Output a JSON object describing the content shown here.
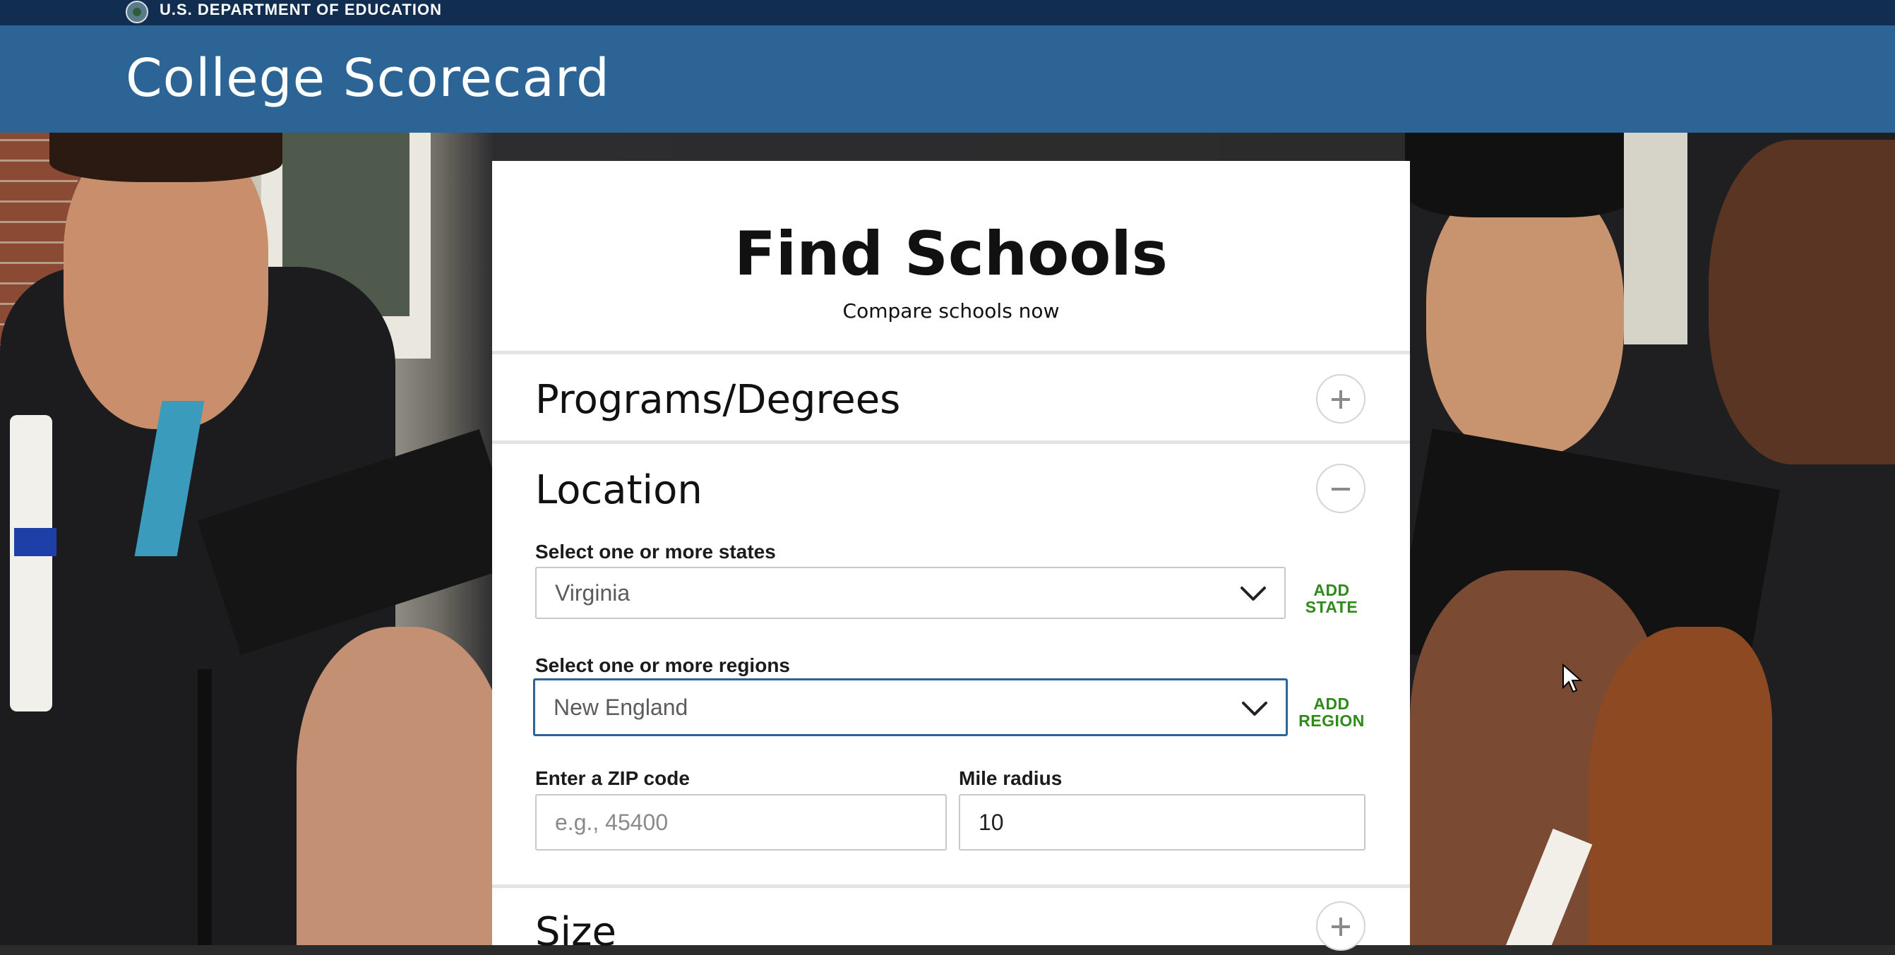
{
  "gov_bar": {
    "text": "U.S. DEPARTMENT OF EDUCATION"
  },
  "header": {
    "title": "College Scorecard"
  },
  "card": {
    "title": "Find Schools",
    "subtitle": "Compare schools now",
    "sections": {
      "programs": {
        "title": "Programs/Degrees",
        "toggle": "plus"
      },
      "location": {
        "title": "Location",
        "toggle": "minus",
        "states_label": "Select one or more states",
        "states_value": "Virginia",
        "add_state": [
          "ADD",
          "STATE"
        ],
        "regions_label": "Select one or more regions",
        "regions_value": "New England",
        "add_region": [
          "ADD",
          "REGION"
        ],
        "zip_label": "Enter a ZIP code",
        "zip_placeholder": "e.g., 45400",
        "zip_value": "",
        "radius_label": "Mile radius",
        "radius_value": "10"
      },
      "size": {
        "title": "Size",
        "toggle": "plus"
      }
    }
  },
  "colors": {
    "gov_bar": "#112e51",
    "header": "#2c6496",
    "accent_green": "#2e8b1a",
    "focus_border": "#2c6496"
  }
}
